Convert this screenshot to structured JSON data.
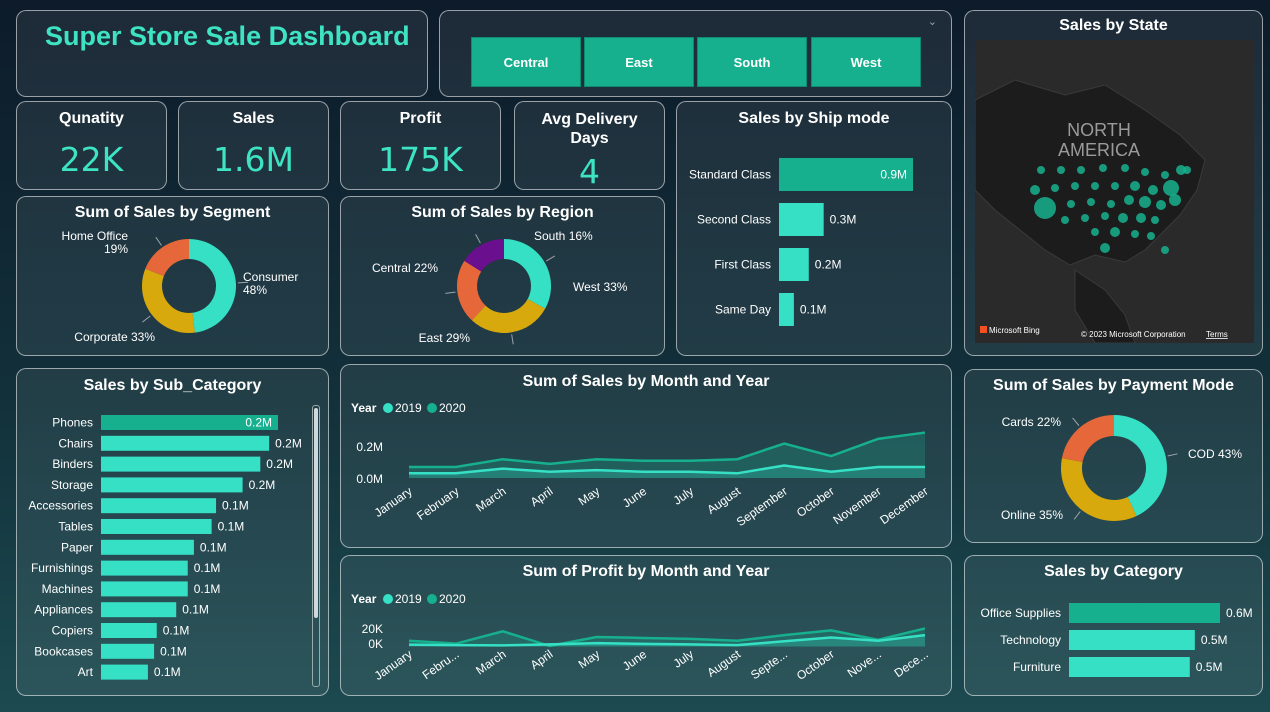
{
  "title": "Super Store Sale Dashboard",
  "regions": [
    "Central",
    "East",
    "South",
    "West"
  ],
  "kpis": {
    "quantity": {
      "label": "Qunatity",
      "value": "22K"
    },
    "sales": {
      "label": "Sales",
      "value": "1.6M"
    },
    "profit": {
      "label": "Profit",
      "value": "175K"
    },
    "delivery": {
      "label": "Avg Delivery Days",
      "value": "4"
    }
  },
  "map": {
    "title": "Sales by State",
    "label_line1": "NORTH",
    "label_line2": "AMERICA",
    "bing": "Microsoft Bing",
    "copyright": "© 2023 Microsoft Corporation",
    "terms": "Terms"
  },
  "colors": {
    "teal": "#17b08e",
    "aqua": "#35e0c4",
    "orange": "#e6683a",
    "gold": "#d8a90d",
    "purple": "#6a0f8e",
    "accent": "#3de3c2"
  },
  "chart_data": [
    {
      "id": "segment",
      "type": "pie",
      "title": "Sum of Sales by Segment",
      "categories": [
        "Consumer",
        "Corporate",
        "Home Office"
      ],
      "values": [
        48,
        33,
        19
      ],
      "labels": [
        "Consumer 48%",
        "Corporate 33%",
        "Home Office 19%"
      ],
      "colors": [
        "#35e0c4",
        "#d8a90d",
        "#e6683a"
      ]
    },
    {
      "id": "region",
      "type": "pie",
      "title": "Sum of Sales by Region",
      "categories": [
        "West",
        "East",
        "Central",
        "South"
      ],
      "values": [
        33,
        29,
        22,
        16
      ],
      "labels": [
        "West 33%",
        "East 29%",
        "Central 22%",
        "South 16%"
      ],
      "colors": [
        "#35e0c4",
        "#d8a90d",
        "#e6683a",
        "#6a0f8e"
      ]
    },
    {
      "id": "shipmode",
      "type": "bar",
      "title": "Sales by Ship mode",
      "categories": [
        "Standard Class",
        "Second Class",
        "First Class",
        "Same Day"
      ],
      "values": [
        0.9,
        0.3,
        0.2,
        0.1
      ],
      "labels": [
        "0.9M",
        "0.3M",
        "0.2M",
        "0.1M"
      ]
    },
    {
      "id": "subcategory",
      "type": "bar",
      "title": "Sales by Sub_Category",
      "categories": [
        "Phones",
        "Chairs",
        "Binders",
        "Storage",
        "Accessories",
        "Tables",
        "Paper",
        "Furnishings",
        "Machines",
        "Appliances",
        "Copiers",
        "Bookcases",
        "Art"
      ],
      "values": [
        0.2,
        0.19,
        0.18,
        0.16,
        0.13,
        0.125,
        0.105,
        0.098,
        0.098,
        0.085,
        0.063,
        0.06,
        0.053
      ],
      "labels": [
        "0.2M",
        "0.2M",
        "0.2M",
        "0.2M",
        "0.1M",
        "0.1M",
        "0.1M",
        "0.1M",
        "0.1M",
        "0.1M",
        "0.1M",
        "0.1M",
        "0.1M"
      ]
    },
    {
      "id": "sales_month",
      "type": "area",
      "title": "Sum of Sales by Month and Year",
      "legend_title": "Year",
      "x": [
        "January",
        "February",
        "March",
        "April",
        "May",
        "June",
        "July",
        "August",
        "September",
        "October",
        "November",
        "December"
      ],
      "yticks": [
        "0.2M",
        "0.0M"
      ],
      "ylim": [
        0,
        0.3
      ],
      "series": [
        {
          "name": "2019",
          "color": "#35e0c4",
          "values": [
            0.03,
            0.03,
            0.06,
            0.04,
            0.05,
            0.04,
            0.04,
            0.03,
            0.08,
            0.04,
            0.07,
            0.07
          ]
        },
        {
          "name": "2020",
          "color": "#17b08e",
          "values": [
            0.07,
            0.07,
            0.12,
            0.09,
            0.12,
            0.11,
            0.11,
            0.12,
            0.22,
            0.14,
            0.25,
            0.29
          ]
        }
      ]
    },
    {
      "id": "profit_month",
      "type": "area",
      "title": "Sum of Profit by Month and Year",
      "legend_title": "Year",
      "x": [
        "January",
        "Febru...",
        "March",
        "April",
        "May",
        "June",
        "July",
        "August",
        "Septe...",
        "October",
        "Nove...",
        "Dece..."
      ],
      "yticks": [
        "20K",
        "0K"
      ],
      "ylim": [
        -10000,
        30000
      ],
      "series": [
        {
          "name": "2019",
          "color": "#35e0c4",
          "values": [
            2000,
            1500,
            1200,
            2200,
            3500,
            2800,
            2200,
            1500,
            5500,
            9500,
            6000,
            12000
          ]
        },
        {
          "name": "2020",
          "color": "#17b08e",
          "values": [
            6000,
            3000,
            16000,
            500,
            10000,
            9000,
            8000,
            6000,
            12000,
            17000,
            7000,
            19000
          ]
        }
      ]
    },
    {
      "id": "payment",
      "type": "pie",
      "title": "Sum of Sales by Payment Mode",
      "categories": [
        "COD",
        "Online",
        "Cards"
      ],
      "values": [
        43,
        35,
        22
      ],
      "labels": [
        "COD 43%",
        "Online 35%",
        "Cards 22%"
      ],
      "colors": [
        "#35e0c4",
        "#d8a90d",
        "#e6683a"
      ]
    },
    {
      "id": "category",
      "type": "bar",
      "title": "Sales by Category",
      "categories": [
        "Office Supplies",
        "Technology",
        "Furniture"
      ],
      "values": [
        0.6,
        0.5,
        0.48
      ],
      "labels": [
        "0.6M",
        "0.5M",
        "0.5M"
      ]
    }
  ]
}
